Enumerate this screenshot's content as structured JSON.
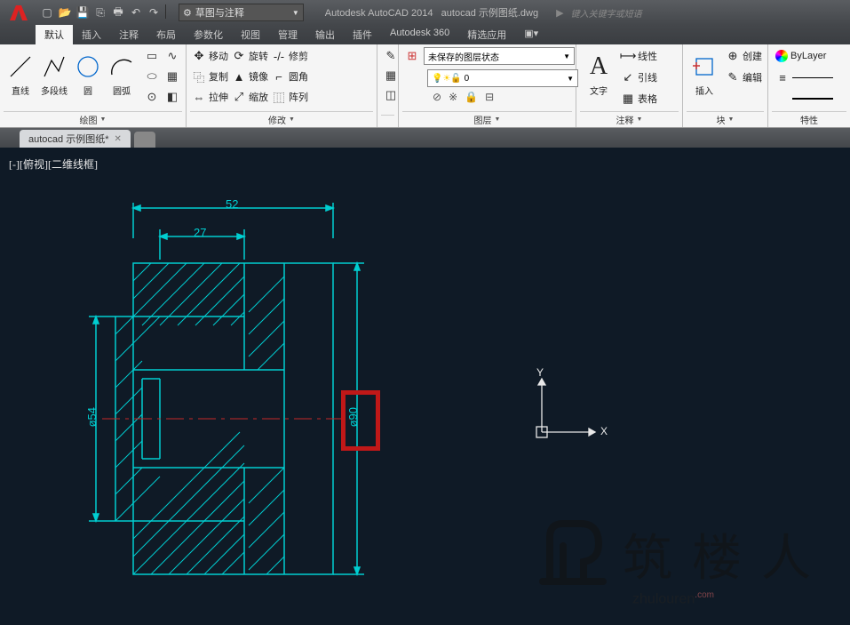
{
  "titlebar": {
    "workspace": "草图与注释",
    "app": "Autodesk AutoCAD 2014",
    "file": "autocad 示例图纸.dwg",
    "search_placeholder": "键入关键字或短语"
  },
  "tabs": [
    "默认",
    "插入",
    "注释",
    "布局",
    "参数化",
    "视图",
    "管理",
    "输出",
    "插件",
    "Autodesk 360",
    "精选应用"
  ],
  "panel_draw": {
    "title": "绘图",
    "tools": {
      "line": "直线",
      "polyline": "多段线",
      "circle": "圆",
      "arc": "圆弧"
    }
  },
  "panel_modify": {
    "title": "修改",
    "r1": {
      "move": "移动",
      "rotate": "旋转",
      "trim": "修剪"
    },
    "r2": {
      "copy": "复制",
      "mirror": "镜像",
      "fillet": "圆角"
    },
    "r3": {
      "stretch": "拉伸",
      "scale": "缩放",
      "array": "阵列"
    }
  },
  "panel_layer": {
    "title": "图层",
    "state": "未保存的图层状态",
    "current": "0"
  },
  "panel_anno": {
    "title": "注释",
    "text": "文字",
    "linear": "线性",
    "leader": "引线",
    "table": "表格"
  },
  "panel_block": {
    "title": "块",
    "insert": "插入",
    "create": "创建",
    "edit": "编辑"
  },
  "panel_props": {
    "title": "特性",
    "bylayer": "ByLayer"
  },
  "filetab": {
    "name": "autocad 示例图纸*"
  },
  "canvas": {
    "viewlabel": "[-][俯视][二维线框]",
    "dim_52": "52",
    "dim_27": "27",
    "dim_54": "ø54",
    "dim_90": "ø90",
    "ucs_x": "X",
    "ucs_y": "Y"
  },
  "watermark": {
    "cn": "筑 楼 人",
    "en": "zhulouren",
    "com": ".com"
  }
}
